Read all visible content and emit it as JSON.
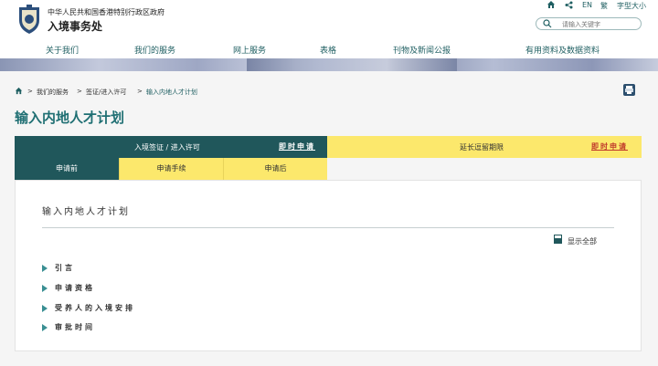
{
  "header": {
    "gov_name": "中华人民共和国香港特别行政区政府",
    "dept_name": "入境事务处"
  },
  "utility": {
    "home_icon": "home-icon",
    "share_icon": "share-icon",
    "lang_en": "EN",
    "lang_tc": "繁",
    "font_size": "字型大小"
  },
  "search": {
    "placeholder": "请输入关键字"
  },
  "nav": [
    {
      "label": "关于我们"
    },
    {
      "label": "我们的服务"
    },
    {
      "label": "网上服务"
    },
    {
      "label": "表格"
    },
    {
      "label": "刊物及新闻公报"
    },
    {
      "label": "有用资料及数据资料"
    }
  ],
  "breadcrumb": {
    "sep": ">",
    "items": [
      "我们的服务",
      "签证/进入许可",
      "输入内地人才计划"
    ]
  },
  "page_title": "输入内地人才计划",
  "tabs": {
    "primary": {
      "label": "入境签证 / 进入许可",
      "link": "即时申请"
    },
    "secondary": {
      "label": "延长逗留期限",
      "link": "即时申请"
    }
  },
  "subtabs": [
    "申请前",
    "申请手续",
    "申请后"
  ],
  "content": {
    "title": "输入内地人才计划",
    "show_all": "显示全部",
    "items": [
      "引言",
      "申请资格",
      "受养人的入境安排",
      "审批时间"
    ]
  },
  "colors": {
    "primary": "#20575b",
    "accent_yellow": "#fce86c",
    "title_teal": "#1f6f73",
    "link_red": "#c0392b"
  }
}
